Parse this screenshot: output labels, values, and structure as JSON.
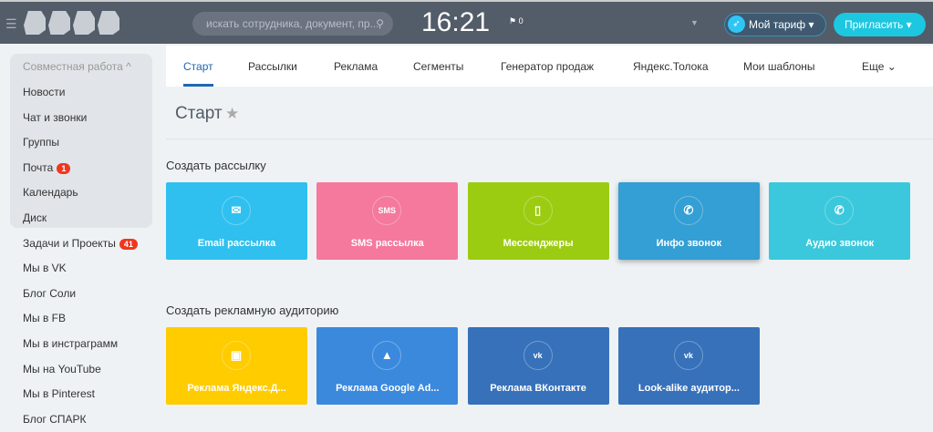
{
  "header": {
    "search_placeholder": "искать сотрудника, документ, пр...",
    "clock": "16:21",
    "flag_count": "0",
    "tariff": "Мой тариф",
    "invite": "Пригласить"
  },
  "sidebar": {
    "group_title": "Совместная работа ^",
    "items": [
      {
        "label": "Новости"
      },
      {
        "label": "Чат и звонки"
      },
      {
        "label": "Группы"
      },
      {
        "label": "Почта",
        "badge": "1"
      },
      {
        "label": "Календарь"
      },
      {
        "label": "Диск"
      },
      {
        "label": "Задачи и Проекты",
        "badge": "41"
      },
      {
        "label": "Мы в VK"
      },
      {
        "label": "Блог Соли"
      },
      {
        "label": "Мы в FB"
      },
      {
        "label": "Мы в инстраграмм"
      },
      {
        "label": "Мы на YouTube"
      },
      {
        "label": "Мы в Pinterest"
      },
      {
        "label": "Блог СПАРК"
      }
    ]
  },
  "tabs": [
    "Старт",
    "Рассылки",
    "Реклама",
    "Сегменты",
    "Генератор продаж",
    "Яндекс.Толока",
    "Мои шаблоны",
    "Еще ⌄"
  ],
  "page_title": "Старт",
  "sections": [
    {
      "title": "Создать рассылку",
      "cards": [
        {
          "label": "Email рассылка",
          "icon": "✉",
          "color": "#2fc0ef"
        },
        {
          "label": "SMS рассылка",
          "icon": "SMS",
          "color": "#f4799d"
        },
        {
          "label": "Мессенджеры",
          "icon": "▯",
          "color": "#9ccc11"
        },
        {
          "label": "Инфо звонок",
          "icon": "✆",
          "color": "#339fd4"
        },
        {
          "label": "Аудио звонок",
          "icon": "✆",
          "color": "#3bc8dc"
        }
      ]
    },
    {
      "title": "Создать рекламную аудиторию",
      "cards": [
        {
          "label": "Реклама Яндекс.Д...",
          "icon": "▣",
          "color": "#ffcc00"
        },
        {
          "label": "Реклама Google Ad...",
          "icon": "▲",
          "color": "#3a89dd"
        },
        {
          "label": "Реклама ВКонтакте",
          "icon": "vk",
          "color": "#3771ba"
        },
        {
          "label": "Look-alike аудитор...",
          "icon": "vk",
          "color": "#3771ba"
        }
      ]
    }
  ]
}
